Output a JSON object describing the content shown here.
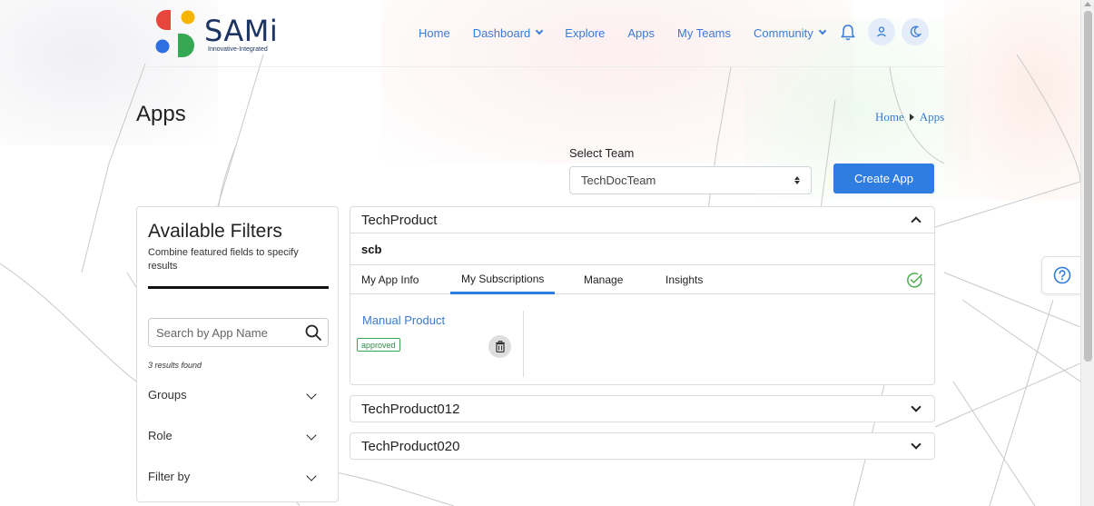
{
  "brand": {
    "name": "SAMi",
    "tagline": "Innovative-Integrated",
    "colors": {
      "red": "#e8453c",
      "yellow": "#f5b400",
      "blue": "#2f6fe0",
      "green": "#34a853",
      "navy": "#1c3461"
    }
  },
  "nav": {
    "home": "Home",
    "dashboard": "Dashboard",
    "explore": "Explore",
    "apps": "Apps",
    "my_teams": "My Teams",
    "community": "Community",
    "icons": [
      "bell-icon",
      "user-icon",
      "moon-icon"
    ]
  },
  "page": {
    "title": "Apps",
    "breadcrumb": [
      "Home",
      "Apps"
    ]
  },
  "team_select": {
    "label": "Select Team",
    "value": "TechDocTeam"
  },
  "create_app_label": "Create App",
  "filters": {
    "title": "Available Filters",
    "subtitle": "Combine featured fields to specify results",
    "search_placeholder": "Search by App Name",
    "results_text": "3 results found",
    "groups": [
      "Groups",
      "Role",
      "Filter by"
    ]
  },
  "products": [
    {
      "name": "TechProduct",
      "expanded": true,
      "app_name": "scb",
      "tabs": [
        "My App Info",
        "My Subscriptions",
        "Manage",
        "Insights"
      ],
      "active_tab": "My Subscriptions",
      "subscriptions": [
        {
          "name": "Manual Product",
          "status": "approved"
        }
      ]
    },
    {
      "name": "TechProduct012",
      "expanded": false
    },
    {
      "name": "TechProduct020",
      "expanded": false
    }
  ],
  "accent_color": "#2f7de1"
}
